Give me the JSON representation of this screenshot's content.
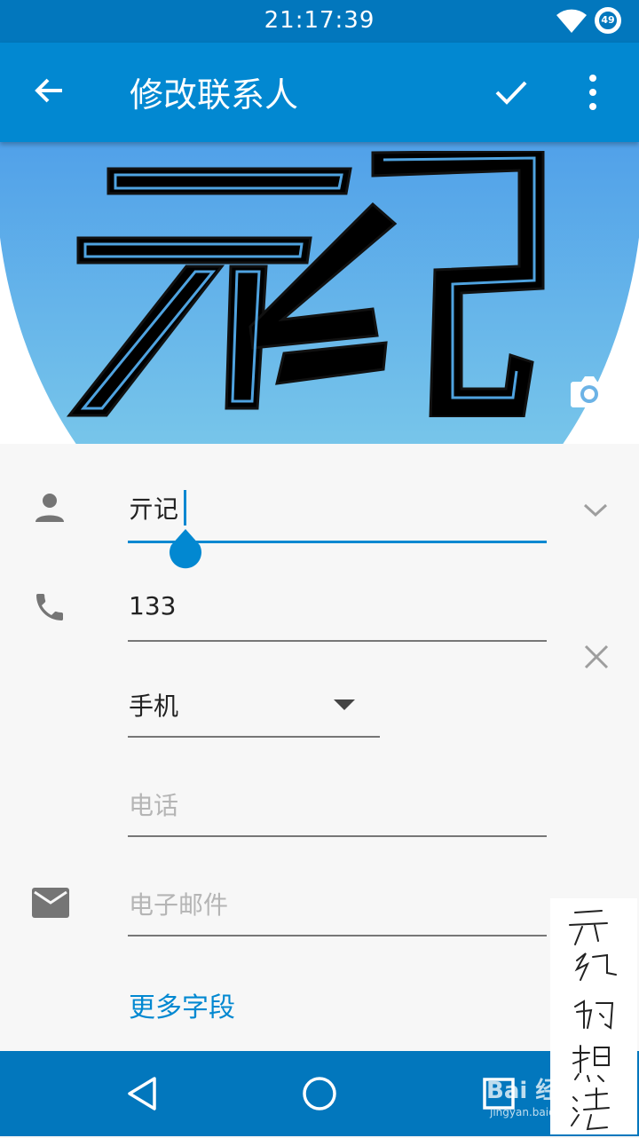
{
  "status_bar": {
    "time": "21:17:39",
    "battery_level": "49"
  },
  "app_bar": {
    "title": "修改联系人"
  },
  "photo": {
    "logo_text": "亓纪"
  },
  "form": {
    "name_value": "亓记",
    "phone_value": "133",
    "phone_type": "手机",
    "phone_placeholder": "电话",
    "email_placeholder": "电子邮件",
    "more_fields": "更多字段"
  },
  "watermark": {
    "baidu": "Bai 经验",
    "baidu_url": "jingyan.baidu.com",
    "handwriting": "亓纪的想法"
  },
  "colors": {
    "primary": "#0288d1",
    "primary_dark": "#0277bd",
    "hint": "#b5b5b5"
  },
  "icons": [
    "back-arrow-icon",
    "check-icon",
    "more-vert-icon",
    "camera-icon",
    "person-icon",
    "phone-icon",
    "expand-icon",
    "close-icon",
    "dropdown-icon",
    "email-icon",
    "nav-back-icon",
    "nav-home-icon",
    "nav-recent-icon"
  ]
}
